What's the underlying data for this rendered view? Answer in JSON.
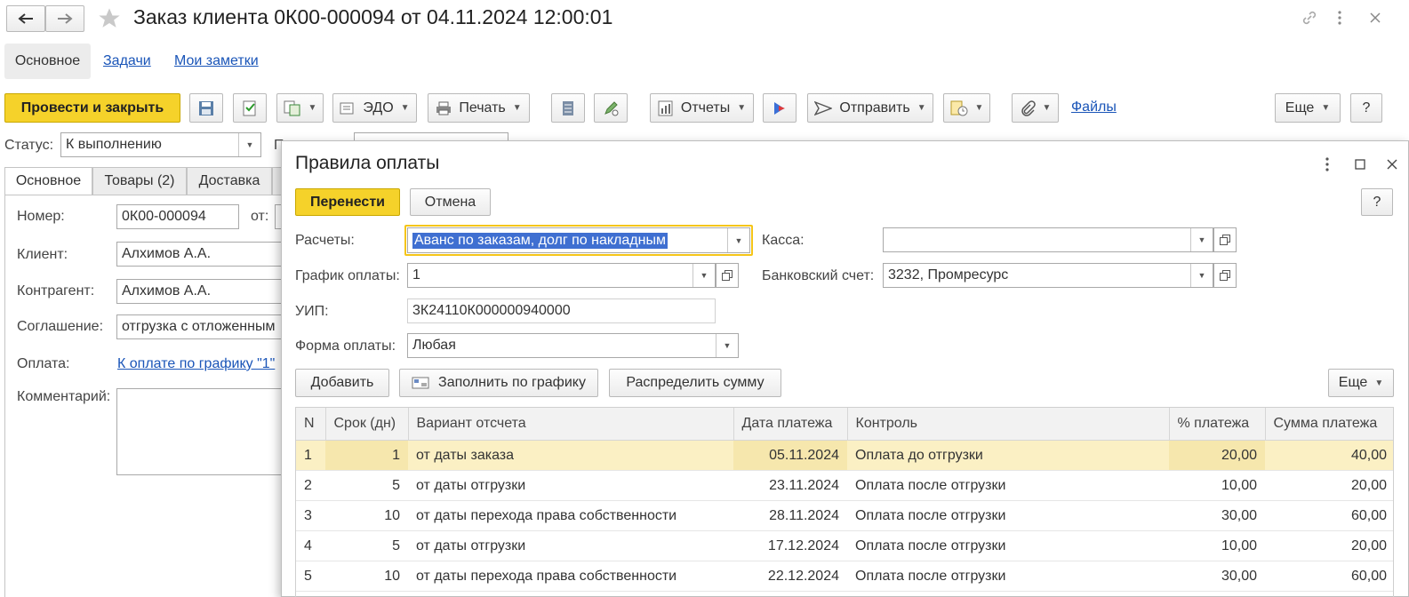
{
  "window": {
    "title": "Заказ клиента 0К00-000094 от 04.11.2024 12:00:01"
  },
  "nav_links": {
    "main": "Основное",
    "tasks": "Задачи",
    "notes": "Мои заметки"
  },
  "toolbar": {
    "post_close": "Провести и закрыть",
    "edo": "ЭДО",
    "print": "Печать",
    "reports": "Отчеты",
    "send": "Отправить",
    "files": "Файлы",
    "more": "Еще",
    "help": "?"
  },
  "status": {
    "label": "Статус:",
    "value": "К выполнению",
    "cut_label": "П"
  },
  "order_tabs": [
    "Основное",
    "Товары (2)",
    "Доставка"
  ],
  "order_form": {
    "number_label": "Номер:",
    "number_value": "0К00-000094",
    "from_label": "от:",
    "client_label": "Клиент:",
    "client_value": "Алхимов А.А.",
    "counterparty_label": "Контрагент:",
    "counterparty_value": "Алхимов А.А.",
    "agreement_label": "Соглашение:",
    "agreement_value": "отгрузка с отложенным",
    "payment_label": "Оплата:",
    "payment_link": "К оплате по графику \"1\"",
    "comment_label": "Комментарий:"
  },
  "dialog": {
    "title": "Правила оплаты",
    "transfer_button": "Перенести",
    "cancel_button": "Отмена",
    "help": "?",
    "settlements_label": "Расчеты:",
    "settlements_value": "Аванс по заказам, долг по накладным",
    "cash_label": "Касса:",
    "cash_value": "",
    "schedule_label": "График оплаты:",
    "schedule_value": "1",
    "bank_label": "Банковский счет:",
    "bank_value": "3232, Промресурс",
    "uip_label": "УИП:",
    "uip_value": "3К24110К000000940000",
    "pay_form_label": "Форма оплаты:",
    "pay_form_value": "Любая",
    "add_button": "Добавить",
    "fill_button": "Заполнить по графику",
    "distribute_button": "Распределить сумму",
    "more_button": "Еще"
  },
  "table": {
    "columns": [
      "N",
      "Срок (дн)",
      "Вариант отсчета",
      "Дата платежа",
      "Контроль",
      "% платежа",
      "Сумма платежа"
    ],
    "rows": [
      {
        "n": "1",
        "term": "1",
        "variant": "от даты заказа",
        "date": "05.11.2024",
        "control": "Оплата до отгрузки",
        "pct": "20,00",
        "sum": "40,00"
      },
      {
        "n": "2",
        "term": "5",
        "variant": "от даты отгрузки",
        "date": "23.11.2024",
        "control": "Оплата после отгрузки",
        "pct": "10,00",
        "sum": "20,00"
      },
      {
        "n": "3",
        "term": "10",
        "variant": "от даты перехода права собственности",
        "date": "28.11.2024",
        "control": "Оплата после отгрузки",
        "pct": "30,00",
        "sum": "60,00"
      },
      {
        "n": "4",
        "term": "5",
        "variant": "от даты отгрузки",
        "date": "17.12.2024",
        "control": "Оплата после отгрузки",
        "pct": "10,00",
        "sum": "20,00"
      },
      {
        "n": "5",
        "term": "10",
        "variant": "от даты перехода права собственности",
        "date": "22.12.2024",
        "control": "Оплата после отгрузки",
        "pct": "30,00",
        "sum": "60,00"
      }
    ]
  },
  "colors": {
    "primary_button": "#f5d22a",
    "selected_row": "#fbf0c4",
    "link": "#1a55b8",
    "percent_text": "#2b8a2b"
  }
}
